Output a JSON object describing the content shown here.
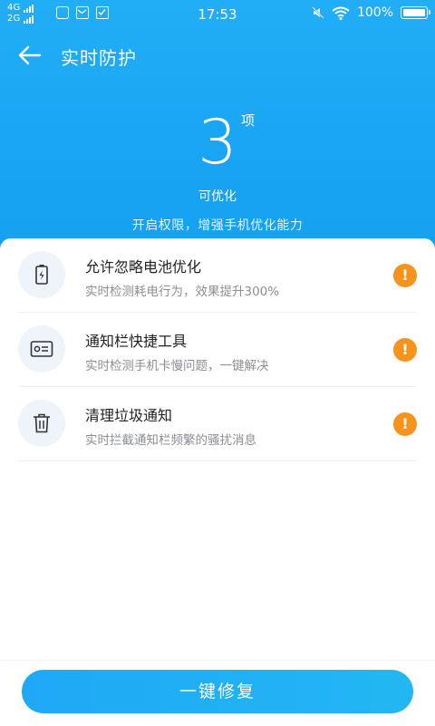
{
  "status_bar": {
    "net1": "4G",
    "net2": "2G",
    "time": "17:53",
    "battery": "100%",
    "icons": [
      "signal-icon",
      "app-notification-icon",
      "mail-icon",
      "check-icon",
      "mute-icon",
      "wifi-icon",
      "battery-icon"
    ]
  },
  "header": {
    "title": "实时防护"
  },
  "summary": {
    "count": "3",
    "unit": "项",
    "label": "可优化",
    "hint": "开启权限，增强手机优化能力"
  },
  "items": [
    {
      "title": "允许忽略电池优化",
      "desc": "实时检测耗电行为，效果提升300%",
      "icon": "battery-charging-icon",
      "status": "!"
    },
    {
      "title": "通知栏快捷工具",
      "desc": "实时检测手机卡慢问题，一键解决",
      "icon": "id-card-icon",
      "status": "!"
    },
    {
      "title": "清理垃圾通知",
      "desc": "实时拦截通知栏频繁的骚扰消息",
      "icon": "trash-icon",
      "status": "!"
    }
  ],
  "action": {
    "fix_label": "一键修复"
  },
  "colors": {
    "header_blue": "#1aa5f3",
    "warning_orange": "#f5931d",
    "icon_bg": "#eef4f9"
  }
}
